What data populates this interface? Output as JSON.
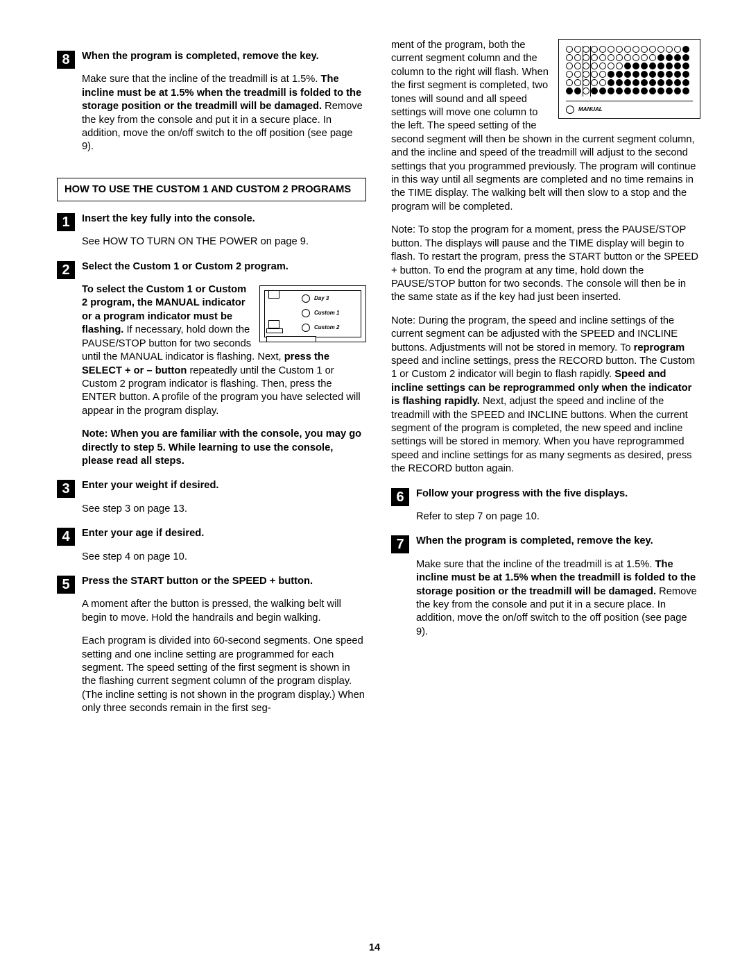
{
  "pageNumber": "14",
  "left": {
    "step8": {
      "num": "8",
      "title": "When the program is completed, remove the key.",
      "p1a": "Make sure that the incline of the treadmill is at 1.5%. ",
      "p1b": "The incline must be at 1.5% when the treadmill is folded to the storage position or the treadmill will be damaged.",
      "p1c": " Remove the key from the console and put it in a secure place. In addition, move the on/off switch to the off position (see page 9)."
    },
    "box_title": "HOW TO USE THE CUSTOM 1 AND CUSTOM 2 PROGRAMS",
    "step1": {
      "num": "1",
      "title": "Insert the key fully into the console.",
      "p": "See HOW TO TURN ON THE POWER on page 9."
    },
    "step2": {
      "num": "2",
      "title": "Select the Custom 1 or Custom 2  program.",
      "p1a": "To select the Custom 1 or Custom 2 program, the MANUAL indicator or a program indicator must be flashing.",
      "p1b": " If necessary, hold down the PAUSE/STOP button for two seconds until the MANUAL indicator is flashing. Next, ",
      "p1c": "press the SELECT + or – button",
      "p1d": " repeatedly until the Custom 1 or Custom 2 program indicator is flashing. Then, press the ENTER button. A profile of the program you have selected will appear in the program display.",
      "note": "Note: When you are familiar with the console, you may go directly to step 5. While learning to use the console, please read all steps.",
      "fig": {
        "day3": "Day 3",
        "c1": "Custom 1",
        "c2": "Custom 2"
      }
    },
    "step3": {
      "num": "3",
      "title": "Enter your weight if desired.",
      "p": "See step 3 on page 13."
    },
    "step4": {
      "num": "4",
      "title": "Enter your age if desired.",
      "p": "See step 4 on page 10."
    },
    "step5": {
      "num": "5",
      "title": "Press the START button or the SPEED + button.",
      "p1": "A moment after the button is pressed, the walking belt will begin to move. Hold the handrails and begin walking.",
      "p2": "Each program is divided into 60-second segments. One speed setting and one incline setting are programmed for each segment. The speed setting of the first segment is shown in the flashing current segment column of the program display. (The incline setting is not shown in the program display.) When only three seconds remain in the first seg-"
    }
  },
  "right": {
    "cont": "ment of the program, both the current segment column and the column to the right will flash. When the first segment is completed, two tones will sound and all speed settings will move one column to the left. The speed setting of the second segment will then be shown in the current segment column, and the incline and speed of the treadmill will adjust to the second settings that you programmed previously. The program will continue in this way until all segments are completed and no time remains in the TIME display. The walking belt will then slow to a stop and the program will be completed.",
    "note1": "Note: To stop the program for a moment, press the PAUSE/STOP button. The displays will pause and the TIME display will begin to flash. To restart the program, press the START button or the SPEED + button. To end the program at any time, hold down the PAUSE/STOP button for two seconds. The console will then be in the same state as if the key had just been inserted.",
    "note2a": "Note: During the program, the speed and incline settings of the current segment can be adjusted with the SPEED and INCLINE buttons. Adjustments will not be stored in memory. To ",
    "note2b": "reprogram",
    "note2c": " speed and incline settings, press the RECORD button. The Custom 1 or Custom 2 indicator will begin to flash rapidly. ",
    "note2d": "Speed and incline settings can be reprogrammed only when the indicator is flashing rapidly.",
    "note2e": " Next, adjust the speed and incline of the treadmill with the SPEED and INCLINE buttons. When the current segment of the program is completed, the new speed and incline settings will be stored in memory. When you have reprogrammed speed and incline settings for as many segments as desired, press the RECORD button again.",
    "step6": {
      "num": "6",
      "title": "Follow your progress with the five displays.",
      "p": "Refer to step 7 on page 10."
    },
    "step7": {
      "num": "7",
      "title": "When the program is completed, remove the key.",
      "p1a": "Make sure that the incline of the treadmill is at 1.5%. ",
      "p1b": "The incline must be at 1.5% when the treadmill is folded to the storage position or the treadmill will be damaged.",
      "p1c": " Remove the key from the console and put it in a secure place. In addition, move the on/off switch to the off position (see page 9)."
    },
    "fig_manual": "MANUAL",
    "profile_rows": [
      [
        0,
        0,
        0,
        0,
        0,
        0,
        0,
        0,
        0,
        0,
        0,
        0,
        0,
        0,
        1
      ],
      [
        0,
        0,
        0,
        0,
        0,
        0,
        0,
        0,
        0,
        0,
        0,
        1,
        1,
        1,
        1
      ],
      [
        0,
        0,
        0,
        0,
        0,
        0,
        0,
        1,
        1,
        1,
        1,
        1,
        1,
        1,
        1
      ],
      [
        0,
        0,
        0,
        0,
        0,
        1,
        1,
        1,
        1,
        1,
        1,
        1,
        1,
        1,
        1
      ],
      [
        0,
        0,
        0,
        0,
        0,
        1,
        1,
        1,
        1,
        1,
        1,
        1,
        1,
        1,
        1
      ],
      [
        1,
        1,
        0,
        1,
        1,
        1,
        1,
        1,
        1,
        1,
        1,
        1,
        1,
        1,
        1
      ]
    ]
  }
}
